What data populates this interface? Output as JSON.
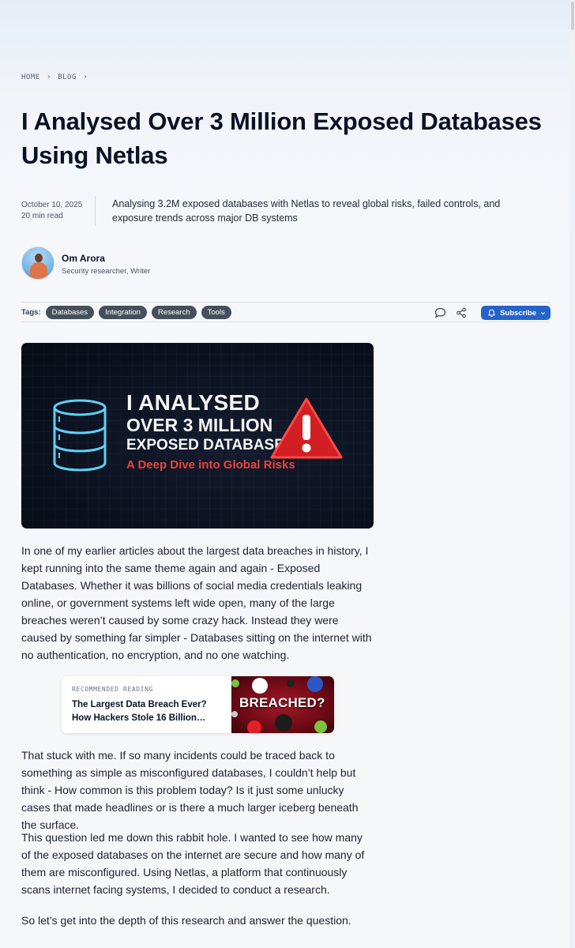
{
  "breadcrumb": {
    "home": "HOME",
    "blog": "BLOG",
    "sep": "›"
  },
  "article": {
    "title": "I Analysed Over 3 Million Exposed Databases Using Netlas",
    "date": "October 10, 2025",
    "read_time": "20 min read",
    "summary": "Analysing 3.2M exposed databases with Netlas to reveal global risks, failed controls, and exposure trends across major DB systems"
  },
  "author": {
    "name": "Om Arora",
    "role": "Security researcher, Writer"
  },
  "tags": {
    "label": "Tags:",
    "items": [
      "Databases",
      "Integration",
      "Research",
      "Tools"
    ]
  },
  "actions": {
    "comment_icon": "comment-icon",
    "share_icon": "share-icon",
    "subscribe_label": "Subscribe"
  },
  "hero": {
    "line1": "I ANALYSED",
    "line2": "OVER 3 MILLION",
    "line3": "EXPOSED DATABASES",
    "subtitle": "A Deep Dive into Global Risks",
    "icons": [
      "database-icon",
      "warning-icon"
    ]
  },
  "body": {
    "p1": "In one of my earlier articles about the largest data breaches in history, I kept running into the same theme again and again - Exposed Databases. Whether it was billions of social media credentials leaking online, or government systems left wide open, many of the large breaches weren’t caused by some crazy hack. Instead they were caused by something far simpler - Databases sitting on the internet with no authentication, no encryption, and no one watching.",
    "p2": "That stuck with me. If so many incidents could be traced back to something as simple as misconfigured databases, I couldn’t help but think - How common is this problem today? Is it just some unlucky cases that made headlines or is there a much larger iceberg beneath the surface.",
    "p3": "This question led me down this rabbit hole. I wanted to see how many of the exposed databases on the internet are secure and how many of them are misconfigured. Using Netlas, a platform that continuously scans internet facing systems, I decided to conduct a research.",
    "p4": "So let’s get into the depth of this research and answer the question."
  },
  "recommended": {
    "kicker": "RECOMMENDED READING",
    "title": "The Largest Data Breach Ever? How Hackers Stole 16 Billion…",
    "thumb_text": "BREACHED?"
  },
  "colors": {
    "accent": "#2563c9",
    "tag_bg": "#474f5c",
    "hero_red": "#e7443a",
    "hero_cyan": "#5ed0f5"
  }
}
